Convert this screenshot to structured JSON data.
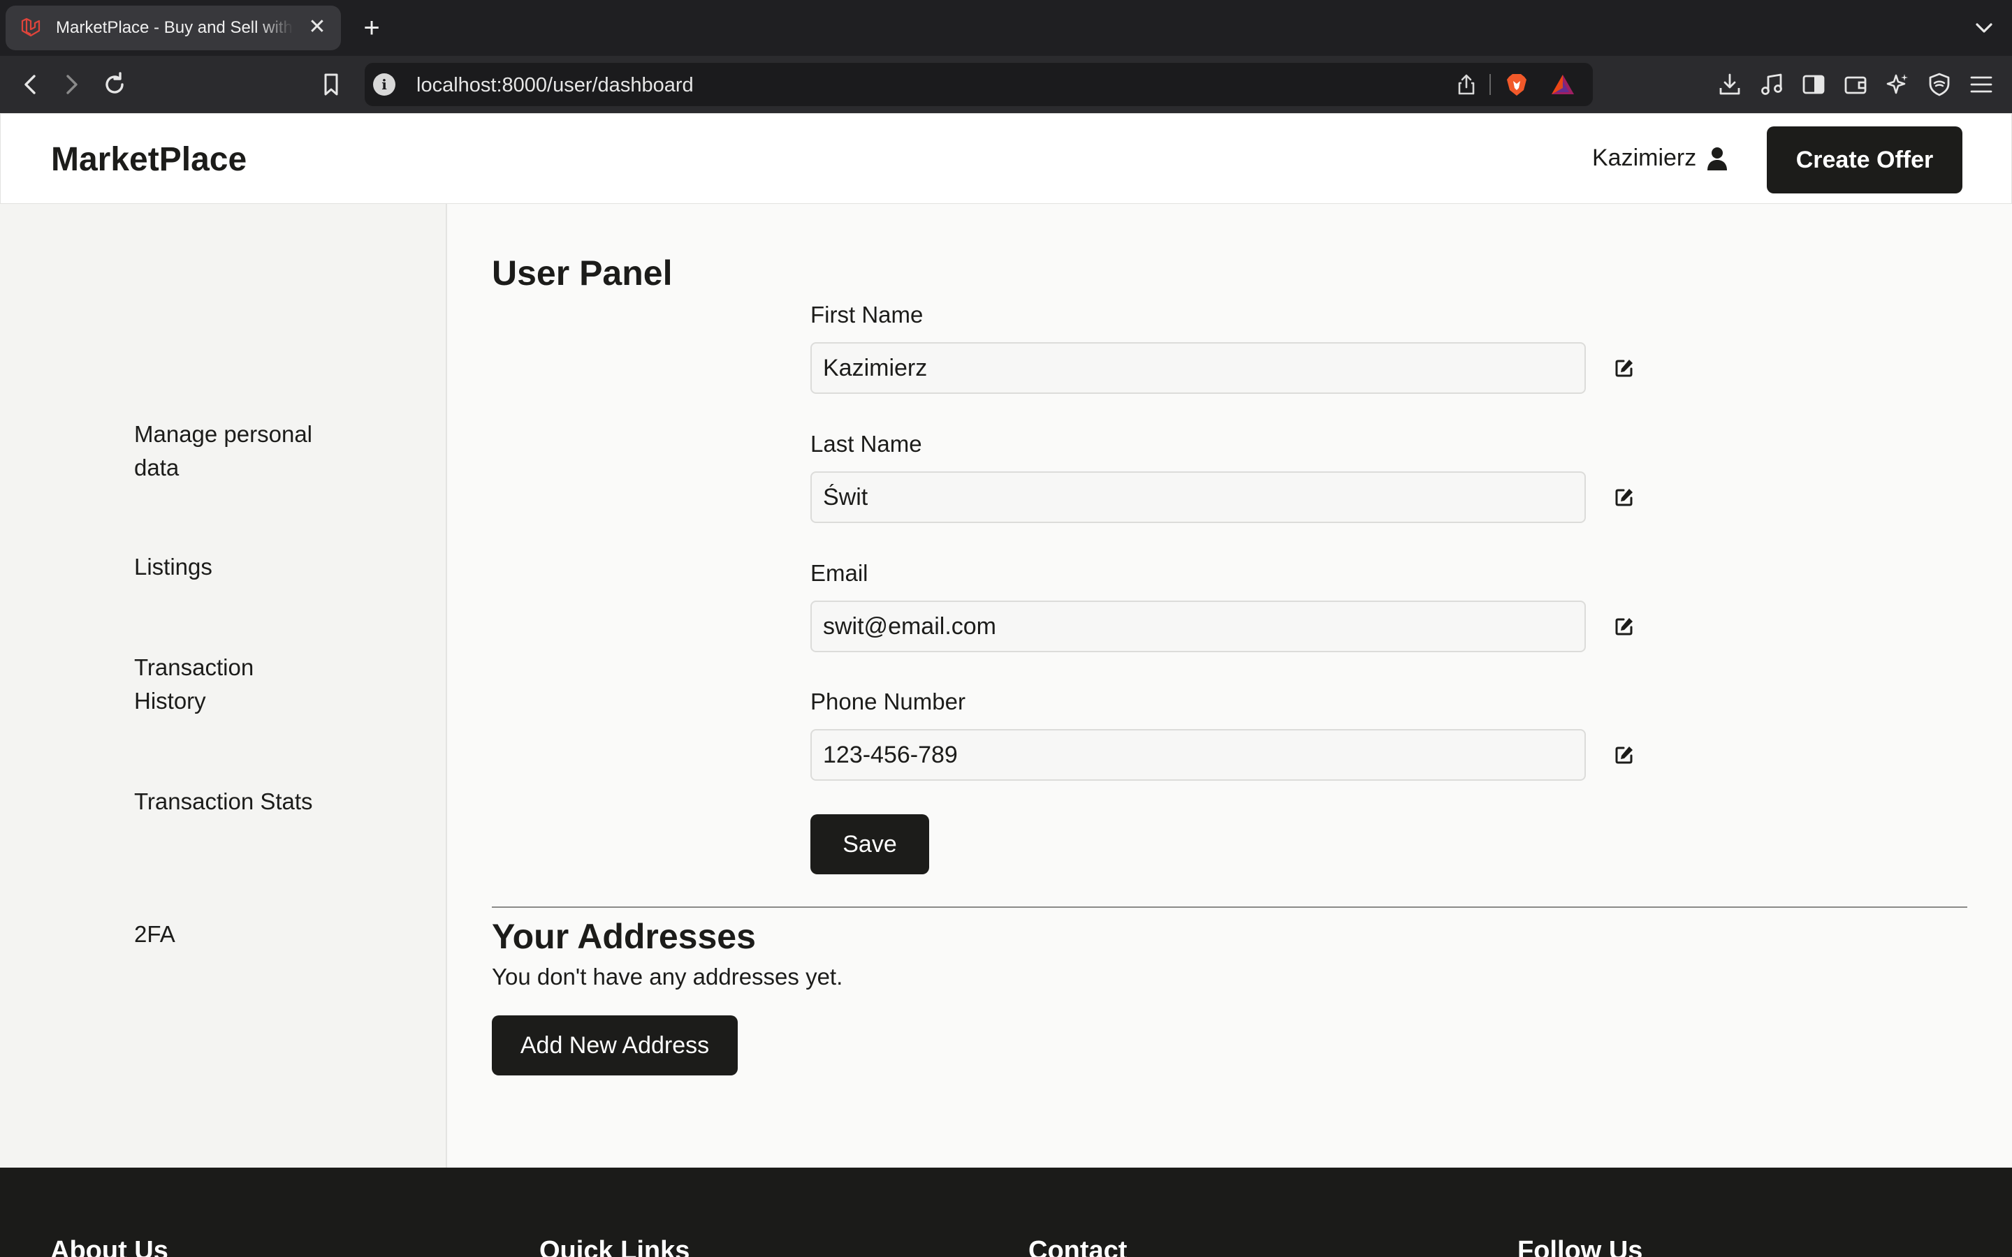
{
  "browser": {
    "tab_title": "MarketPlace - Buy and Sell with",
    "tab_close": "✕",
    "new_tab": "+",
    "url": "localhost:8000/user/dashboard"
  },
  "header": {
    "brand": "MarketPlace",
    "username": "Kazimierz",
    "create_offer_label": "Create Offer"
  },
  "sidebar": {
    "items": [
      {
        "label": "Manage personal data"
      },
      {
        "label": "Listings"
      },
      {
        "label": "Transaction History"
      },
      {
        "label": "Transaction Stats"
      },
      {
        "label": "2FA"
      }
    ]
  },
  "main": {
    "title": "User Panel",
    "fields": [
      {
        "label": "First Name",
        "value": "Kazimierz"
      },
      {
        "label": "Last Name",
        "value": "Świt"
      },
      {
        "label": "Email",
        "value": "swit@email.com"
      },
      {
        "label": "Phone Number",
        "value": "123-456-789"
      }
    ],
    "save_label": "Save",
    "addresses_title": "Your Addresses",
    "addresses_empty": "You don't have any addresses yet.",
    "add_address_label": "Add New Address"
  },
  "footer": {
    "headings": [
      "About Us",
      "Quick Links",
      "Contact",
      "Follow Us"
    ]
  },
  "colors": {
    "primary": "#1c1c1a",
    "page_bg": "#fafaf9",
    "sidebar_bg": "#f4f4f2",
    "footer_bg": "#1b1b19"
  },
  "icons": {
    "tab_favicon": "laravel-logo-icon",
    "user": "user-icon",
    "edit": "edit-icon"
  }
}
